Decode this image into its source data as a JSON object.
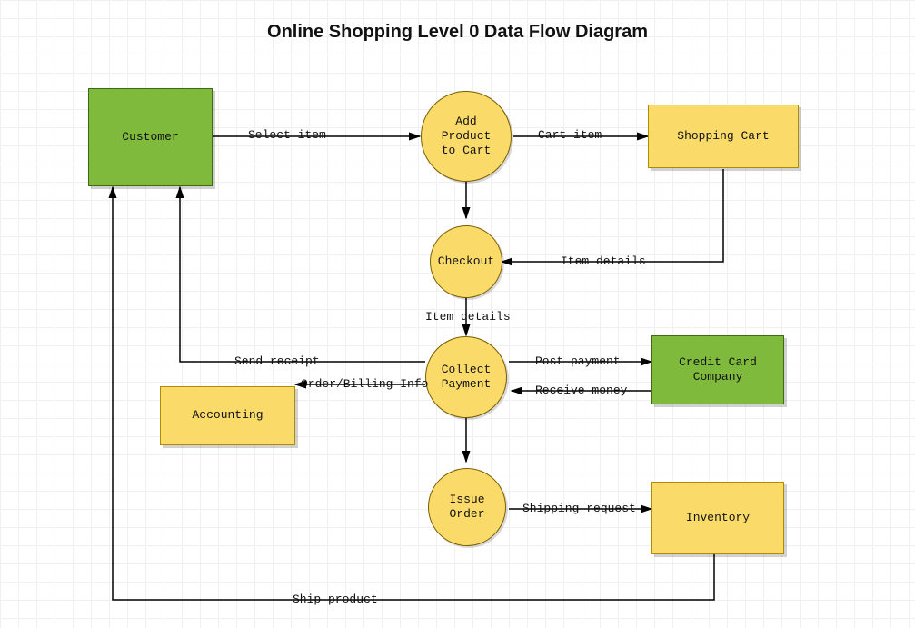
{
  "title": "Online Shopping Level 0 Data Flow Diagram",
  "nodes": {
    "customer": "Customer",
    "add_product": "Add\nProduct\nto Cart",
    "shopping_cart": "Shopping Cart",
    "checkout": "Checkout",
    "collect_payment": "Collect\nPayment",
    "credit_card": "Credit Card\nCompany",
    "accounting": "Accounting",
    "issue_order": "Issue\nOrder",
    "inventory": "Inventory"
  },
  "edges": {
    "select_item": "Select item",
    "cart_item": "Cart item",
    "item_details_1": "Item details",
    "item_details_2": "Item details",
    "send_receipt": "Send receipt",
    "order_billing": "Order/Billing Info",
    "post_payment": "Post payment",
    "receive_money": "Receive money",
    "shipping_request": "Shipping request",
    "ship_product": "Ship product"
  }
}
